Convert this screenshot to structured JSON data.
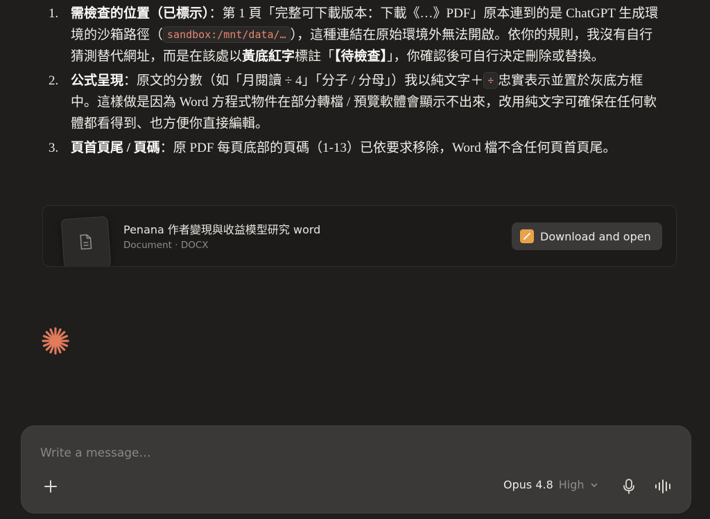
{
  "message": {
    "items": [
      {
        "number": "1.",
        "bold": "需檢查的位置（已標示）",
        "text_before_code": "：第 1 頁「完整可下載版本：下載《…》PDF」原本連到的是 ChatGPT 生成環境的沙箱路徑（",
        "code": "sandbox:/mnt/data/…",
        "text_after_code": "），這種連結在原始環境外無法開啟。依你的規則，我沒有自行猜測替代網址，而是在該處以",
        "bold2": "黃底紅字",
        "text_mid": "標註「",
        "bold3": "【待檢查】",
        "text_end": "」，你確認後可自行決定刪除或替換。"
      },
      {
        "number": "2.",
        "bold": "公式呈現",
        "text_before_code": "：原文的分數（如「月閱讀 ÷ 4」「分子 / 分母」）我以純文字＋",
        "code": "÷",
        "text_after_code": "忠實表示並置於灰底方框中。這樣做是因為 Word 方程式物件在部分轉檔 / 預覽軟體會顯示不出來，改用純文字可確保在任何軟體都看得到、也方便你直接編輯。"
      },
      {
        "number": "3.",
        "bold": "頁首頁尾 / 頁碼",
        "text": "：原 PDF 每頁底部的頁碼（1-13）已依要求移除，Word 檔不含任何頁首頁尾。"
      }
    ]
  },
  "file_card": {
    "title": "Penana 作者變現與收益模型研究 word",
    "subtitle": "Document · DOCX",
    "download_label": "Download and open",
    "icon": "document-icon"
  },
  "composer": {
    "placeholder": "Write a message…",
    "model_name": "Opus 4.8",
    "effort_level": "High"
  },
  "colors": {
    "background": "#1f1e1d",
    "code_text": "#e98670",
    "spark": "#e27a5c",
    "download_icon": "#e9a24a"
  }
}
